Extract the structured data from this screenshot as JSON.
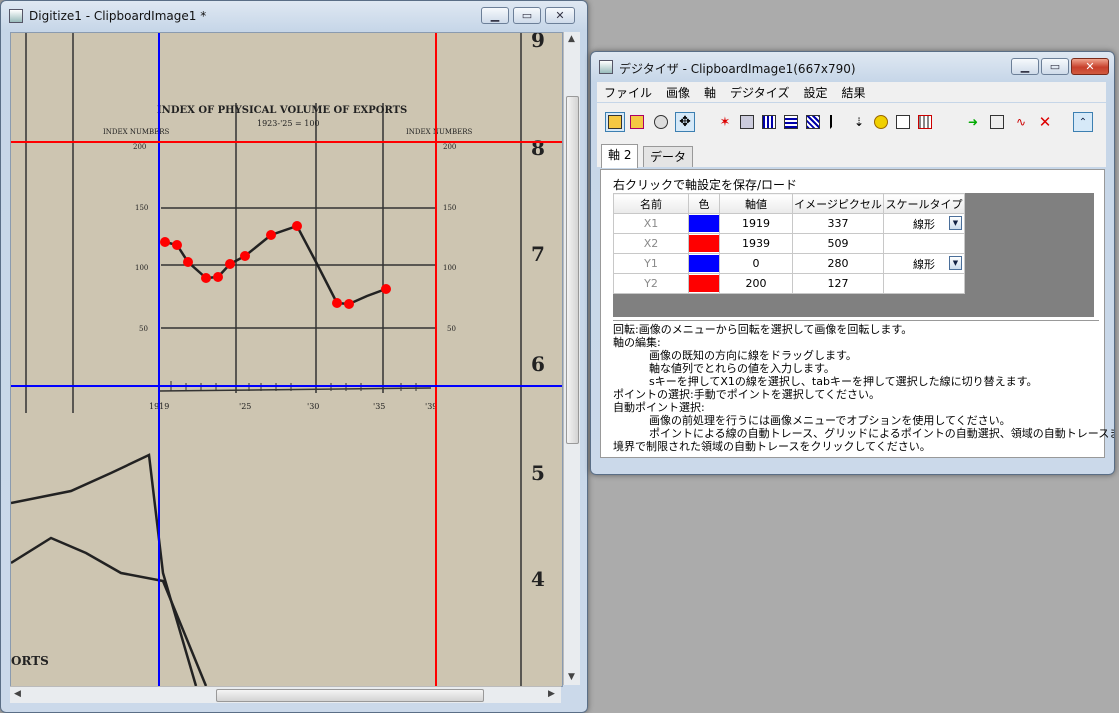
{
  "left_window": {
    "title": "Digitize1 - ClipboardImage1 *",
    "buttons": {
      "minimize": "▁",
      "maximize": "▭",
      "close": "✕"
    },
    "image": {
      "chart_title": "INDEX OF PHYSICAL VOLUME OF EXPORTS",
      "chart_subtitle": "1923-'25 = 100",
      "left_header": "INDEX NUMBERS",
      "right_header": "INDEX NUMBERS",
      "y_ticks_left": [
        "200",
        "150",
        "100",
        "50"
      ],
      "y_ticks_right": [
        "200",
        "150",
        "100",
        "50"
      ],
      "x_ticks": [
        "1919",
        "'25",
        "'30",
        "'35",
        "'39"
      ],
      "page_numbers": [
        "9",
        "8",
        "7",
        "6",
        "5",
        "4"
      ],
      "bottom_text": "ORTS"
    }
  },
  "right_window": {
    "title": "デジタイザ - ClipboardImage1(667x790)",
    "buttons": {
      "minimize": "▁",
      "maximize": "▭",
      "close": "✕"
    },
    "menu": [
      "ファイル",
      "画像",
      "軸",
      "デジタイズ",
      "設定",
      "結果"
    ],
    "toolbar_icons": [
      "open-image-icon",
      "open-file-icon",
      "rotate-icon",
      "move-axes-icon",
      "points-icon",
      "line-icon",
      "grid-icon",
      "region-icon",
      "box-icon",
      "axis-icon",
      "sort-icon",
      "undo-icon",
      "add-icon",
      "delete-points-icon",
      "export-icon",
      "columns-icon",
      "trace-icon",
      "clear-icon",
      "collapse-icon"
    ],
    "tabs": [
      "軸 2",
      "データ"
    ],
    "hint": "右クリックで軸設定を保存/ロード",
    "table": {
      "headers": [
        "名前",
        "色",
        "軸値",
        "イメージピクセル",
        "スケールタイプ"
      ],
      "rows": [
        {
          "name": "X1",
          "color": "#0000ff",
          "value": "1919",
          "pixel": "337",
          "scale": "線形"
        },
        {
          "name": "X2",
          "color": "#ff0000",
          "value": "1939",
          "pixel": "509",
          "scale": ""
        },
        {
          "name": "Y1",
          "color": "#0000ff",
          "value": "0",
          "pixel": "280",
          "scale": "線形"
        },
        {
          "name": "Y2",
          "color": "#ff0000",
          "value": "200",
          "pixel": "127",
          "scale": ""
        }
      ]
    },
    "help_lines": [
      "回転:画像のメニューから回転を選択して画像を回転します。",
      "軸の編集:",
      "画像の既知の方向に線をドラッグします。",
      "軸な値列でとれらの値を入力します。",
      "sキーを押してX1の線を選択し、tabキーを押して選択した線に切り替えます。",
      "ポイントの選択:手動でポイントを選択してください。",
      "自動ポイント選択:",
      "画像の前処理を行うには画像メニューでオプションを使用してください。",
      "ポイントによる線の自動トレース、グリッドによるポイントの自動選択、領域の自動トレースまたは",
      "境界で制限された領域の自動トレースをクリックしてください。"
    ]
  }
}
